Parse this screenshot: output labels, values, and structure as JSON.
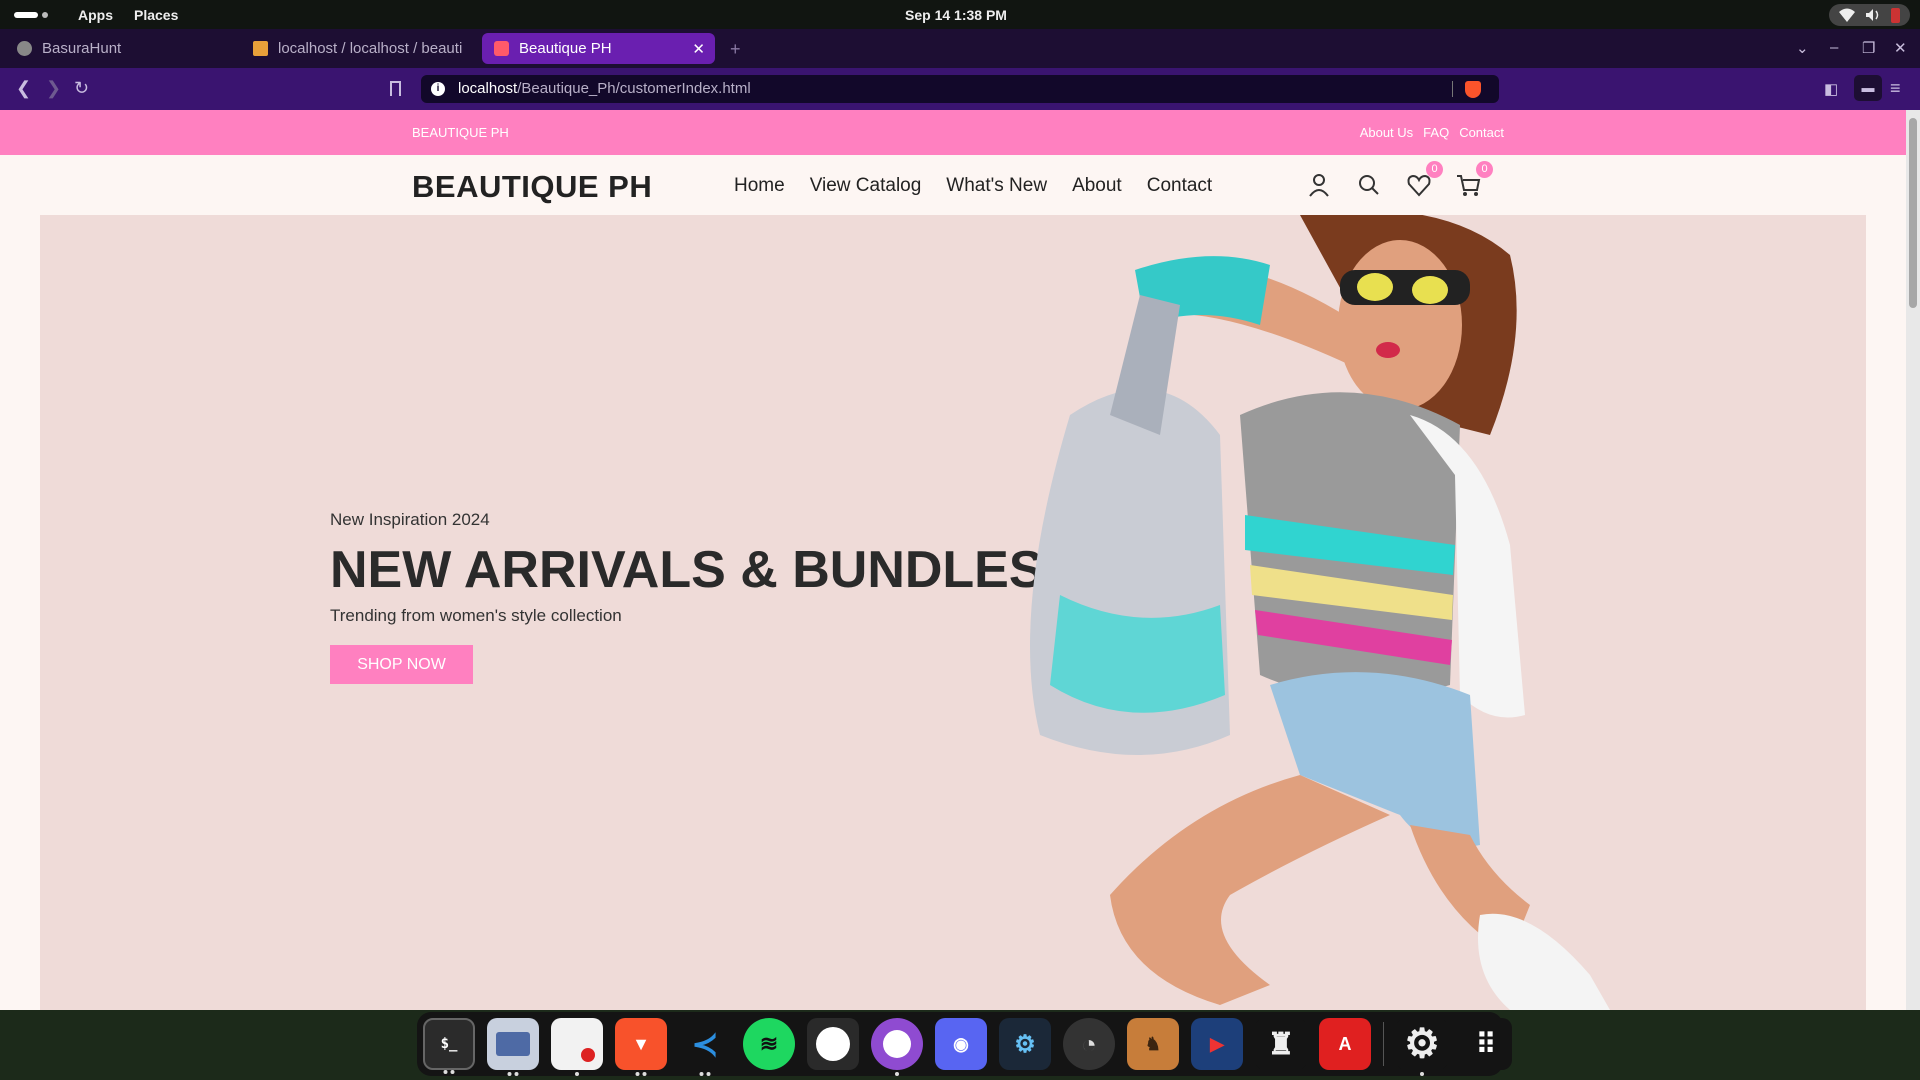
{
  "system": {
    "menus": [
      "Apps",
      "Places"
    ],
    "clock": "Sep 14   1:38 PM"
  },
  "browser": {
    "tabs": [
      {
        "title": "BasuraHunt",
        "active": false
      },
      {
        "title": "localhost / localhost / beauti",
        "active": false
      },
      {
        "title": "Beautique PH",
        "active": true
      }
    ],
    "new_tab": "+",
    "url_host": "localhost",
    "url_path": "/Beautique_Ph/customerIndex.html"
  },
  "page": {
    "promo_brand": "BEAUTIQUE PH",
    "promo_links": [
      "About Us",
      "FAQ",
      "Contact"
    ],
    "logo": "BEAUTIQUE PH",
    "nav": [
      "Home",
      "View Catalog",
      "What's New",
      "About",
      "Contact"
    ],
    "wishlist_count": "0",
    "cart_count": "0",
    "hero": {
      "kicker": "New Inspiration 2024",
      "heading": "NEW ARRIVALS & BUNDLES",
      "subheading": "Trending from women's style collection",
      "cta": "SHOP NOW"
    }
  },
  "colors": {
    "accent_pink": "#ff80c0",
    "hero_bg": "#efdbd8",
    "browser_chrome": "#3a1470"
  },
  "dock": {
    "apps": [
      "terminal",
      "files",
      "text-editor",
      "brave",
      "vscode",
      "spotify",
      "github-desktop",
      "github-purple",
      "discord",
      "steam",
      "obs",
      "game",
      "media-app",
      "brush-tool",
      "acrobat",
      "settings",
      "app-grid"
    ]
  }
}
